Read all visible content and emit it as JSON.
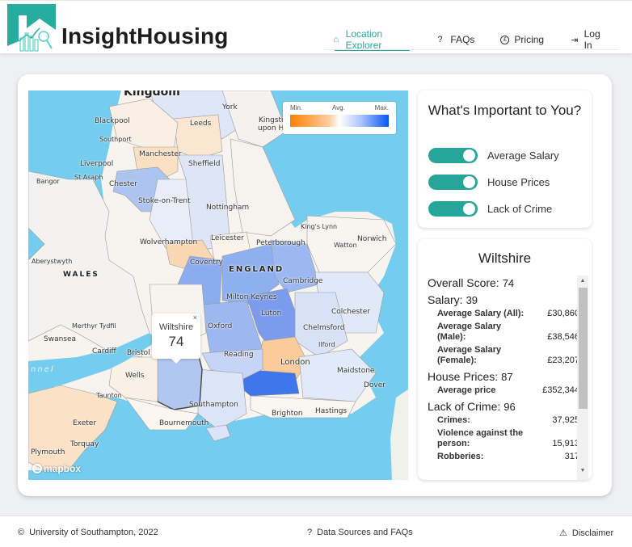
{
  "header": {
    "brand": "InsightHousing",
    "nav": [
      {
        "label": "Location Explorer",
        "icon": "home-icon",
        "glyph": "⌂",
        "active": true
      },
      {
        "label": "FAQs",
        "icon": "question-icon",
        "glyph": "?",
        "active": false
      },
      {
        "label": "Pricing",
        "icon": "pound-coin-icon",
        "glyph": "£",
        "active": false
      },
      {
        "label": "Log In",
        "icon": "login-icon",
        "glyph": "⇥",
        "active": false
      }
    ]
  },
  "map": {
    "legend": {
      "min": "Min.",
      "avg": "Avg.",
      "max": "Max."
    },
    "popup": {
      "region": "Wiltshire",
      "score": "74",
      "close": "×"
    },
    "attribution": "mapbox",
    "labels": {
      "kingdom": "Kingdom",
      "york": "York",
      "blackpool": "Blackpool",
      "leeds": "Leeds",
      "kingston": "Kingston",
      "upon_hull": "upon Hu",
      "southport": "Southport",
      "manchester": "Manchester",
      "liverpool": "Liverpool",
      "sheffield": "Sheffield",
      "st_asaph": "St Asaph",
      "bangor": "Bangor",
      "chester": "Chester",
      "stoke": "Stoke-on-Trent",
      "nottingham": "Nottingham",
      "kings_lynn": "King's Lynn",
      "wolverhampton": "Wolverhampton",
      "leicester": "Leicester",
      "peterborough": "Peterborough",
      "watton": "Watton",
      "norwich": "Norwich",
      "aberystwyth": "Aberystwyth",
      "coventry": "Coventry",
      "england": "ENGLAND",
      "wales": "WALES",
      "cambridge": "Cambridge",
      "milton_keynes": "Milton Keynes",
      "luton": "Luton",
      "colchester": "Colchester",
      "merthyr": "Merthyr Tydfil",
      "oxford": "Oxford",
      "chelmsford": "Chelmsford",
      "swansea": "Swansea",
      "cardiff": "Cardiff",
      "bristol": "Bristol",
      "ilford": "Ilford",
      "reading": "Reading",
      "london": "London",
      "maidstone": "Maidstone",
      "channel": "nnel",
      "wells": "Wells",
      "dover": "Dover",
      "taunton": "Taunton",
      "southampton": "Southampton",
      "brighton": "Brighton",
      "hastings": "Hastings",
      "exeter": "Exeter",
      "bournemouth": "Bournemouth",
      "torquay": "Torquay",
      "plymouth": "Plymouth"
    }
  },
  "preferences": {
    "title": "What's Important to You?",
    "toggles": [
      {
        "label": "Average Salary",
        "on": true
      },
      {
        "label": "House Prices",
        "on": true
      },
      {
        "label": "Lack of Crime",
        "on": true
      }
    ]
  },
  "details": {
    "region": "Wiltshire",
    "overall": {
      "label": "Overall Score:",
      "value": "74"
    },
    "salary": {
      "label": "Salary:",
      "value": "39",
      "items": [
        {
          "k": "Average Salary (All):",
          "v": "£30,860"
        },
        {
          "k": "Average Salary (Male):",
          "v": "£38,546"
        },
        {
          "k": "Average Salary (Female):",
          "v": "£23,207"
        }
      ]
    },
    "house": {
      "label": "House Prices:",
      "value": "87",
      "items": [
        {
          "k": "Average price",
          "v": "£352,344"
        }
      ]
    },
    "crime": {
      "label": "Lack of Crime:",
      "value": "96",
      "items": [
        {
          "k": "Crimes:",
          "v": "37,925"
        },
        {
          "k": "Violence against the person:",
          "v": "15,913"
        },
        {
          "k": "Robberies:",
          "v": "317"
        }
      ]
    }
  },
  "footer": {
    "copyright": "University of Southampton, 2022",
    "faq": "Data Sources and FAQs",
    "disclaimer": "Disclaimer"
  },
  "colors": {
    "accent": "#26a69a",
    "sea": "#74cdee",
    "min": "#ff8000",
    "max": "#0a56f0"
  }
}
